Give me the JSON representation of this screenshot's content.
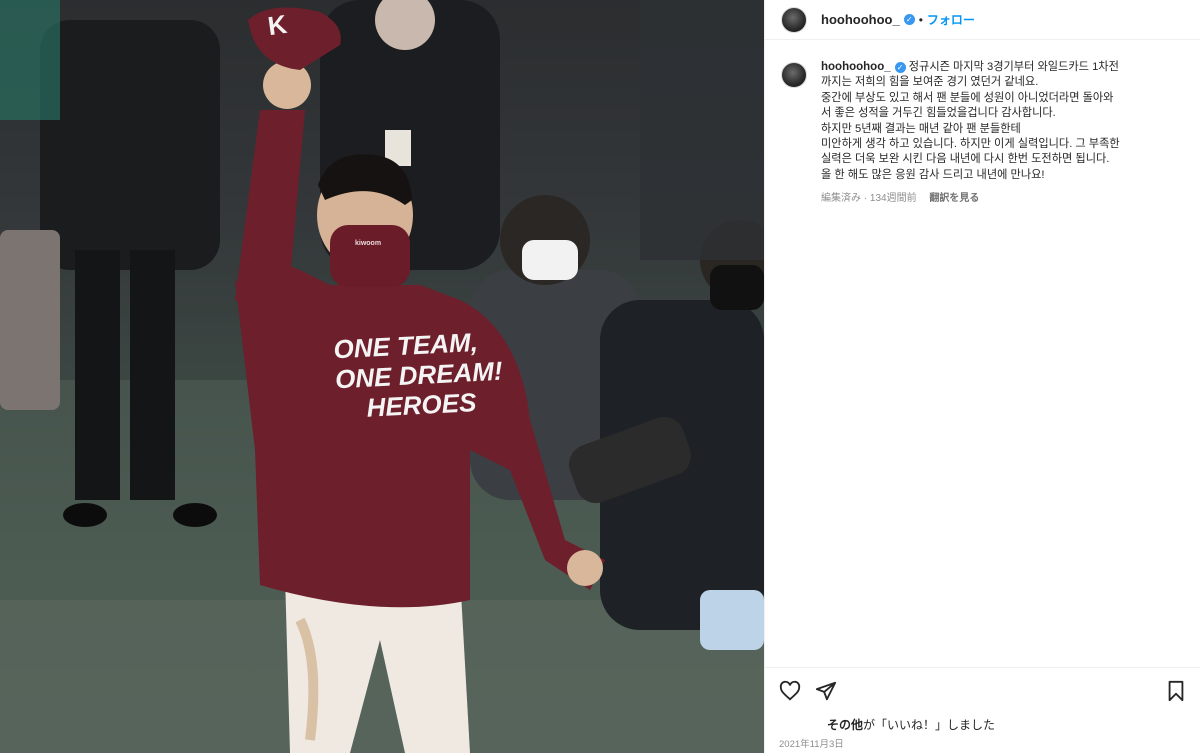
{
  "account": {
    "username": "hoohoohoo_",
    "follow_label": "フォロー",
    "separator": "•"
  },
  "caption": {
    "lines": [
      "정규시즌 마지막 3경기부터 와일드카드 1차전",
      "까지는 저희의 힘을 보여준 경기 였던거 같네요.",
      "중간에 부상도 있고 해서 팬 분들에 성원이 아니었더라면 돌아와",
      "서 좋은 성적을 거두긴 힘들었을겁니다 감사합니다.",
      "하지만 5년째 결과는 매년 같아 팬 분들한테",
      "미안하게 생각 하고 있습니다. 하지만 이게 실력입니다. 그 부족한",
      "실력은 더욱 보완 시킨 다음 내년에 다시 한번 도전하면 됩니다.",
      "올 한 해도 많은 응원 감사 드리고 내년에 만나요!"
    ],
    "edited": "編集済み",
    "age": "134週間前",
    "translate": "翻訳を見る"
  },
  "likes_text": {
    "who": "その他",
    "rest": "が「いいね！」しました"
  },
  "date": "2021年11月3日",
  "photo": {
    "cap_letter": "K",
    "hoodie_text_line1": "ONE TEAM,",
    "hoodie_text_line2": "ONE DREAM!",
    "hoodie_text_line3": "HEROES",
    "mask_text": "kiwoom"
  },
  "icons": {
    "verified": "verified-badge-icon",
    "like": "heart-icon",
    "share": "share-plane-icon",
    "save": "bookmark-icon"
  },
  "colors": {
    "accent": "#0095f6",
    "verified": "#3897f0",
    "hoodie": "#6e1f2c",
    "text": "#262626",
    "muted": "#8e8e8e"
  }
}
